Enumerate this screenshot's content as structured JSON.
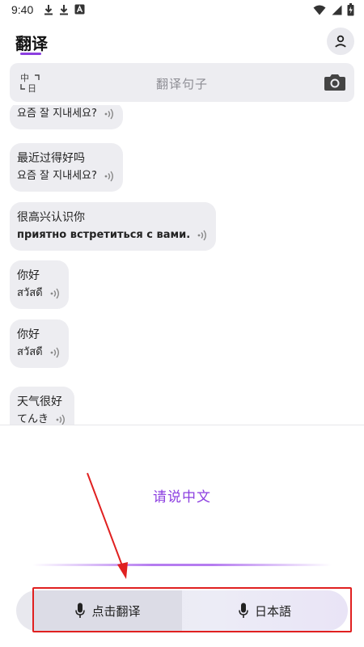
{
  "status_bar": {
    "time": "9:40",
    "icons_left": [
      "download-icon",
      "download-icon",
      "font-icon"
    ],
    "icons_right": [
      "wifi-icon",
      "signal-icon",
      "battery-icon"
    ]
  },
  "header": {
    "title": "翻译",
    "accent_color": "#8c3fe0"
  },
  "search": {
    "placeholder": "翻译句子",
    "left_icon": "language-switch-icon",
    "right_icon": "camera-icon"
  },
  "messages": [
    {
      "source": "",
      "target": "요즘 잘 지내세요?",
      "bold": false
    },
    {
      "source": "最近过得好吗",
      "target": "요즘 잘 지내세요?",
      "bold": false
    },
    {
      "source": "很高兴认识你",
      "target": "приятно встретиться с вами.",
      "bold": true
    },
    {
      "source": "你好",
      "target": "สวัสดี",
      "bold": false
    },
    {
      "source": "你好",
      "target": "สวัสดี",
      "bold": false
    },
    {
      "source": "天气很好",
      "target": "てんき",
      "bold": false
    }
  ],
  "voice_panel": {
    "prompt": "请说中文"
  },
  "bottom_bar": {
    "left_button": "点击翻译",
    "right_button": "日本語"
  }
}
